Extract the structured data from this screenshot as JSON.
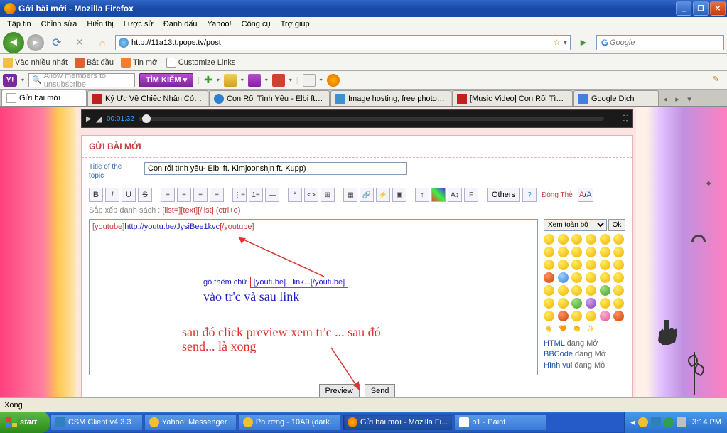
{
  "window": {
    "title": "Gởi bài mới - Mozilla Firefox"
  },
  "menu": [
    "Tập tin",
    "Chỉnh sửa",
    "Hiển thị",
    "Lược sử",
    "Đánh dấu",
    "Yahoo!",
    "Công cụ",
    "Trợ giúp"
  ],
  "url": "http://11a13tt.pops.tv/post",
  "search_placeholder": "Google",
  "bookmarks": [
    {
      "label": "Vào nhiều nhất"
    },
    {
      "label": "Bắt đầu"
    },
    {
      "label": "Tin mới"
    },
    {
      "label": "Customize Links"
    }
  ],
  "yahoo": {
    "search_text": "Allow members to unsubscribe",
    "search_btn": "TÌM KIẾM"
  },
  "tabs": [
    {
      "label": "Gửi bài mới",
      "active": true
    },
    {
      "label": "Ký Ức Về Chiếc Nhẫn Cỏ - Ông C..."
    },
    {
      "label": "Con Rối Tình Yêu - Elbi ft. Kimjoo..."
    },
    {
      "label": "Image hosting, free photo sharin..."
    },
    {
      "label": "[Music Video] Con Rối Tình Yêu El..."
    },
    {
      "label": "Google Dịch"
    }
  ],
  "media": {
    "time": "00:01:32"
  },
  "post": {
    "header": "GỬI BÀI MỚI",
    "title_label": "Title of the topic",
    "title_value": "Con rối tình yêu- Elbi ft. Kimjoonshjn ft. Kupp)",
    "sort_prefix": "Sắp xếp danh sách : ",
    "sort_code": "[list=][text][/list] (ctrl+o)",
    "others": "Others",
    "dong_the": "Đóng Thẻ",
    "yt_open": "[youtube]",
    "yt_url": "http://youtu.be/JysiBee1kvc",
    "yt_close": "[/youtube]"
  },
  "annotations": {
    "line1a": "gõ thêm chữ",
    "line1b": "[youtube]...link...[/youtube]",
    "line2": "vào tr'c và sau link",
    "line3": "sau đó click preview xem tr'c ... sau đó",
    "line4": "send... là xong"
  },
  "emoji": {
    "select": "Xem toàn bộ",
    "ok": "Ok",
    "status": [
      {
        "k": "HTML",
        "v": "đang Mở"
      },
      {
        "k": "BBCode",
        "v": "đang Mở"
      },
      {
        "k": "Hình vui",
        "v": "đang Mở"
      }
    ]
  },
  "buttons": {
    "preview": "Preview",
    "send": "Send"
  },
  "status": "Xong",
  "taskbar": {
    "start": "start",
    "tasks": [
      {
        "label": "CSM Client v4.3.3"
      },
      {
        "label": "Yahoo! Messenger"
      },
      {
        "label": "Phương - 10A9 (dark..."
      },
      {
        "label": "Gửi bài mới - Mozilla Fi...",
        "active": true
      },
      {
        "label": "b1 - Paint"
      }
    ],
    "clock": "3:14 PM"
  }
}
